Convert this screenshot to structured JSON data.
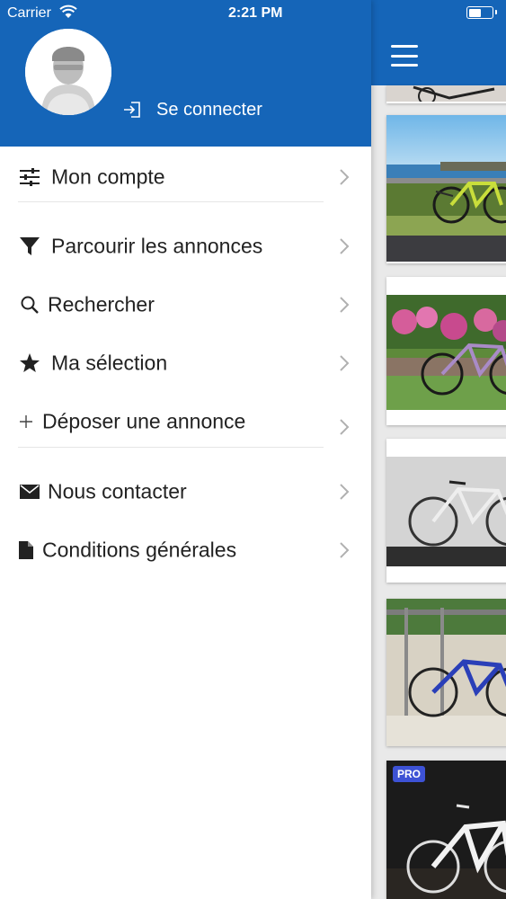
{
  "status_bar": {
    "carrier": "Carrier",
    "time": "2:21 PM"
  },
  "drawer": {
    "login_label": "Se connecter",
    "menu": [
      {
        "label": "Mon compte",
        "icon": "sliders-icon"
      },
      {
        "label": "Parcourir les annonces",
        "icon": "filter-icon"
      },
      {
        "label": "Rechercher",
        "icon": "search-icon"
      },
      {
        "label": "Ma sélection",
        "icon": "star-icon"
      },
      {
        "label": "Déposer une annonce",
        "icon": "plus-icon"
      },
      {
        "label": "Nous contacter",
        "icon": "envelope-icon"
      },
      {
        "label": "Conditions générales",
        "icon": "document-icon"
      }
    ]
  },
  "listing": {
    "badge": "PRO"
  },
  "colors": {
    "header_blue": "#1565b8",
    "badge_blue": "#3d52d5"
  }
}
